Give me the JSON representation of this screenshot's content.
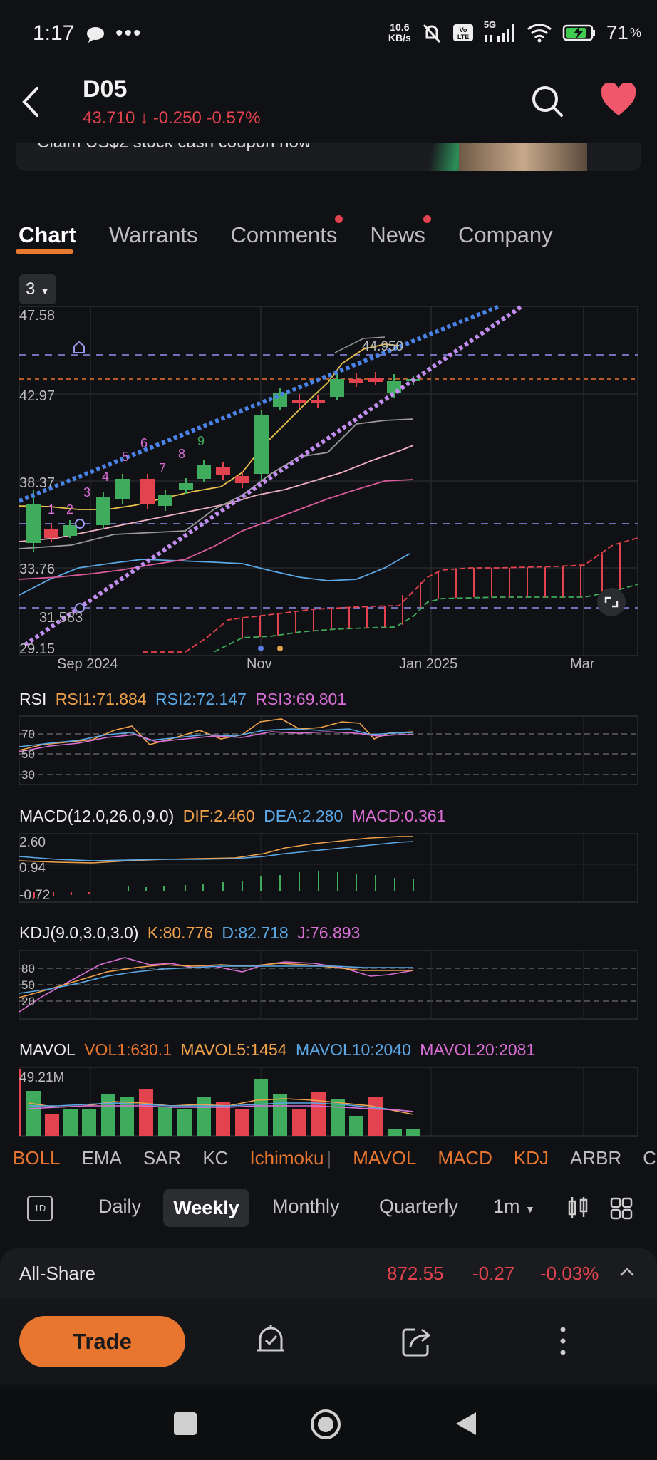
{
  "status_bar": {
    "time": "1:17",
    "net_speed_value": "10.6",
    "net_speed_unit": "KB/s",
    "network": "5G",
    "battery": "71"
  },
  "header": {
    "symbol": "D05",
    "price": "43.710",
    "change": "-0.250",
    "change_pct": "-0.57%"
  },
  "banner": {
    "text": "Claim US$2 stock cash coupon now"
  },
  "tabs": [
    {
      "label": "Chart",
      "active": true,
      "dot": false
    },
    {
      "label": "Warrants",
      "active": false,
      "dot": false
    },
    {
      "label": "Comments",
      "active": false,
      "dot": true
    },
    {
      "label": "News",
      "active": false,
      "dot": true
    },
    {
      "label": "Company",
      "active": false,
      "dot": false
    }
  ],
  "chart_selector": "3",
  "main_chart": {
    "y_ticks": [
      "47.58",
      "42.97",
      "38.37",
      "33.76",
      "31.583",
      "29.15"
    ],
    "x_ticks": [
      "Sep 2024",
      "Nov",
      "Jan 2025",
      "Mar"
    ],
    "high_label": "44.950",
    "sequence_green": [
      "1",
      "2",
      "3",
      "4",
      "5",
      "6",
      "7",
      "8",
      "9"
    ]
  },
  "rsi": {
    "name": "RSI",
    "rsi1": "RSI1:71.884",
    "rsi2": "RSI2:72.147",
    "rsi3": "RSI3:69.801",
    "levels": [
      "70",
      "50",
      "30"
    ]
  },
  "macd": {
    "name": "MACD(12.0,26.0,9.0)",
    "dif": "DIF:2.460",
    "dea": "DEA:2.280",
    "macd": "MACD:0.361",
    "ticks": [
      "2.60",
      "0.94",
      "-0.72"
    ]
  },
  "kdj": {
    "name": "KDJ(9.0,3.0,3.0)",
    "k": "K:80.776",
    "d": "D:82.718",
    "j": "J:76.893",
    "levels": [
      "80",
      "50",
      "20"
    ]
  },
  "mavol": {
    "name": "MAVOL",
    "vol1": "VOL1:630.1",
    "mavol5": "MAVOL5:1454",
    "mavol10": "MAVOL10:2040",
    "mavol20": "MAVOL20:2081",
    "max_label": "49.21M"
  },
  "indicators": [
    {
      "label": "BOLL",
      "color": "#e8762e"
    },
    {
      "label": "EMA",
      "color": "#bdbdbd"
    },
    {
      "label": "SAR",
      "color": "#bdbdbd"
    },
    {
      "label": "KC",
      "color": "#bdbdbd"
    },
    {
      "label": "Ichimoku",
      "color": "#e8762e"
    },
    {
      "label": "MAVOL",
      "color": "#e8762e"
    },
    {
      "label": "MACD",
      "color": "#e8762e"
    },
    {
      "label": "KDJ",
      "color": "#e8762e"
    },
    {
      "label": "ARBR",
      "color": "#bdbdbd"
    },
    {
      "label": "C",
      "color": "#bdbdbd"
    }
  ],
  "periods": {
    "icon_label": "1D",
    "daily": "Daily",
    "weekly": "Weekly",
    "monthly": "Monthly",
    "quarterly": "Quarterly",
    "minute": "1m"
  },
  "all_share": {
    "label": "All-Share",
    "value": "872.55",
    "change": "-0.27",
    "change_pct": "-0.03%"
  },
  "bottom": {
    "trade": "Trade"
  },
  "colors": {
    "up": "#3eab5d",
    "down": "#e2434e",
    "accent": "#e8762e",
    "rsi1": "#f0a24b",
    "rsi2": "#5aa9e6",
    "rsi3": "#d96fd6"
  }
}
